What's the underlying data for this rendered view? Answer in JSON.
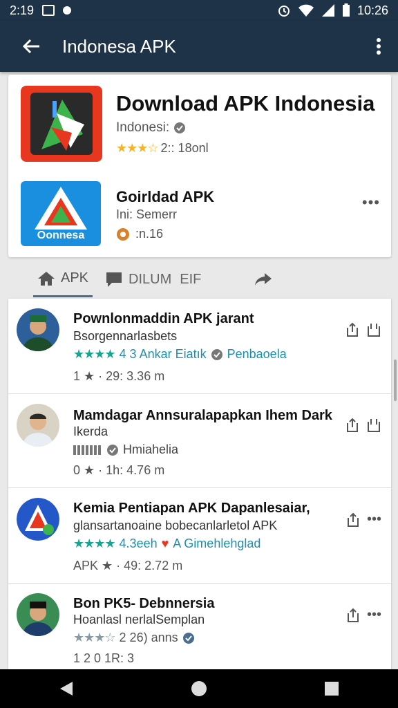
{
  "status": {
    "time_left": "2:19",
    "time_right": "10:26"
  },
  "appbar": {
    "title": "Indonesa APK"
  },
  "top_card": {
    "title": "Download APK Indonesia",
    "subtitle": "Indonesi:",
    "rating": "2:: 18onl",
    "second_title": "Goirldad APK",
    "second_sub": "Ini: Semerr",
    "second_meta": ":n.16",
    "second_icon_label": "Oonnesa"
  },
  "tabs": [
    {
      "label": "APK"
    },
    {
      "label": "DILUM"
    },
    {
      "label": "EIF"
    }
  ],
  "rows": [
    {
      "title": "Pownlonmaddin APK jarant",
      "subtitle": "Bsorgennarlasbets",
      "rating": "4 3 Ankar Eiatık",
      "publisher": "Penbaoela",
      "meta": "1 ★ · 29: 3.36 m"
    },
    {
      "title": "Mamdagar Annsuralapapkan Ihem Dark",
      "subtitle": "Ikerda",
      "rating": "Hmiahelia",
      "meta": "0 ★ · 1h: 4.76 m"
    },
    {
      "title": "Kemia Pentiapan APK Dapanlesaiar,",
      "subtitle": "glansartanoaine bobecanlarletol APK",
      "rating": "4.3eeh",
      "publisher": "A Gimehlehglad",
      "meta": "APK ★ · 49: 2.72 m"
    },
    {
      "title": "Bon PK5- Debnnersia",
      "subtitle": "Hoanlasl nerlalSemplan",
      "rating": "2 26) anns",
      "meta": "1 2 0 1R: 3"
    }
  ],
  "colors": {
    "appbar": "#1e3347",
    "accent_teal": "#1aa38f",
    "star_gold": "#f5b42c"
  }
}
